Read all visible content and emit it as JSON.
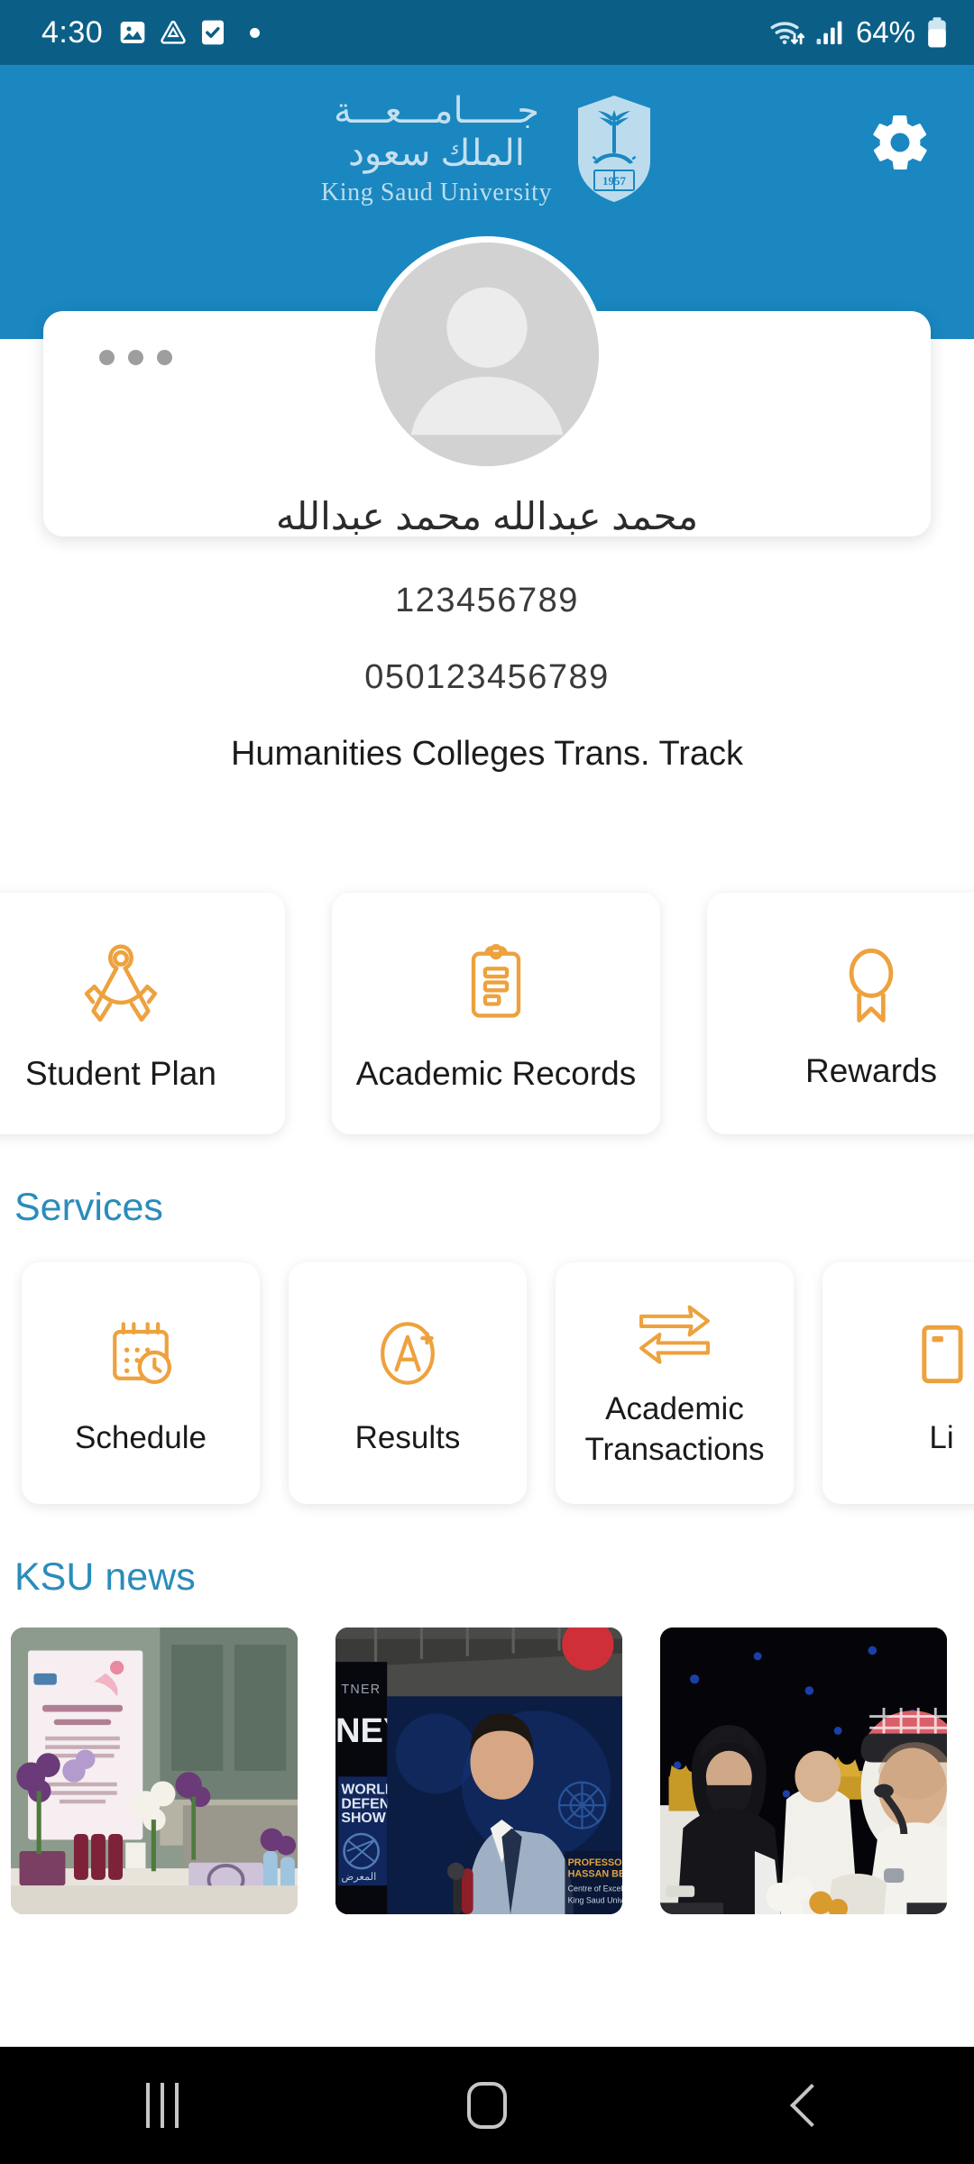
{
  "status_bar": {
    "clock": "4:30",
    "battery_percent": "64%",
    "left_icons": [
      "image-icon",
      "drive-icon",
      "tasks-icon",
      "dot-indicator-icon"
    ],
    "right_icons": [
      "wifi-icon",
      "cellular-signal-icon",
      "battery-icon"
    ],
    "background_color": "#0b5f87"
  },
  "header": {
    "background_color": "#1a87c0",
    "logo_arabic_line1": "جـــــامـــعـــة",
    "logo_arabic_line2": "الملك سعود",
    "logo_english": "King Saud University",
    "crest_year": "1957",
    "settings_icon": "gear-icon"
  },
  "profile": {
    "overflow_menu": "more-options-icon",
    "avatar": "default-user-avatar",
    "name": "محمد عبدالله محمد عبدالله",
    "student_id": "123456789",
    "phone": "050123456789",
    "track": "Humanities Colleges Trans. Track"
  },
  "quick_actions": [
    {
      "label": "Student Plan",
      "icon": "compass-divider-icon"
    },
    {
      "label": "Academic Records",
      "icon": "clipboard-records-icon"
    },
    {
      "label": "Rewards",
      "icon": "award-medal-icon"
    }
  ],
  "services_section": {
    "title": "Services",
    "title_color": "#2a8cbb",
    "items": [
      {
        "label": "Schedule",
        "icon": "calendar-clock-icon"
      },
      {
        "label": "Results",
        "icon": "grade-a-plus-icon"
      },
      {
        "label": "Academic\nTransactions",
        "label_line1": "Academic",
        "label_line2": "Transactions",
        "icon": "transfer-arrows-icon"
      },
      {
        "label": "Li",
        "icon": "library-book-icon"
      }
    ]
  },
  "news_section": {
    "title": "KSU news",
    "title_color": "#2a8cbb",
    "items": [
      {
        "description": "International Women's Day event table with flowers and pink banner"
      },
      {
        "description": "Speaker on large screen at World Defense Show"
      },
      {
        "description": "Panel attendees seated at an awards ceremony"
      }
    ]
  },
  "nav_bar": {
    "buttons": [
      "recents-button",
      "home-button",
      "back-button"
    ],
    "background_color": "#000000"
  },
  "theme": {
    "accent_orange": "#eda23e",
    "brand_blue": "#1a87c0",
    "status_blue": "#0b5f87"
  }
}
